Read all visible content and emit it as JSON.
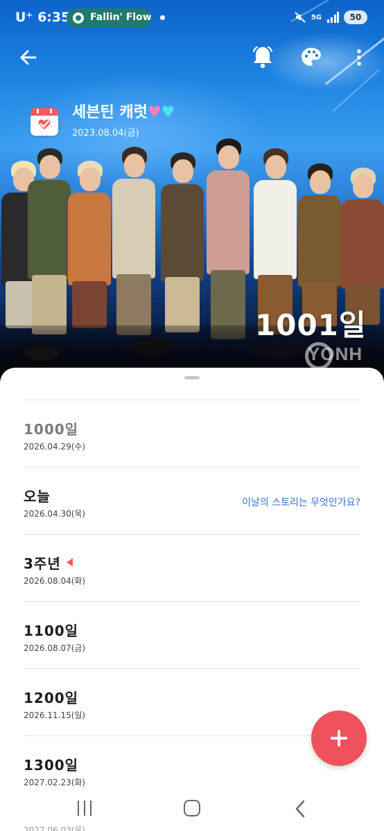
{
  "status_bar": {
    "carrier_time": "U⁺ 6:35",
    "media_title": "Fallin' Flow",
    "network": "5G",
    "battery": "50"
  },
  "hero": {
    "title_text": "세븐틴 캐럿",
    "start_date": "2023.08.04(금)",
    "day_count": "1001일",
    "watermark": "YONH"
  },
  "events": [
    {
      "name": "1000일",
      "date": "2026.04.29(수)",
      "state": "past"
    },
    {
      "name": "오늘",
      "date": "2026.04.30(목)",
      "state": "today",
      "story": "이날의 스토리는 무엇인가요?"
    },
    {
      "name": "3주년",
      "date": "2026.08.04(화)",
      "state": "anniversary"
    },
    {
      "name": "1100일",
      "date": "2026.08.07(금)",
      "state": "future"
    },
    {
      "name": "1200일",
      "date": "2026.11.15(일)",
      "state": "future"
    },
    {
      "name": "1300일",
      "date": "2027.02.23(화)",
      "state": "future"
    }
  ],
  "peek_text": "2027.06.03(목)",
  "icons": {
    "back": "arrow-left-icon",
    "bell": "bell-icon",
    "palette": "palette-icon",
    "more": "more-vertical-icon",
    "calendar": "calendar-heart-icon",
    "fab": "plus-icon"
  },
  "colors": {
    "accent": "#f0525d",
    "link": "#3c6fd1",
    "pink_heart": "#ff7fbf",
    "cyan_heart": "#4fe3ef"
  }
}
